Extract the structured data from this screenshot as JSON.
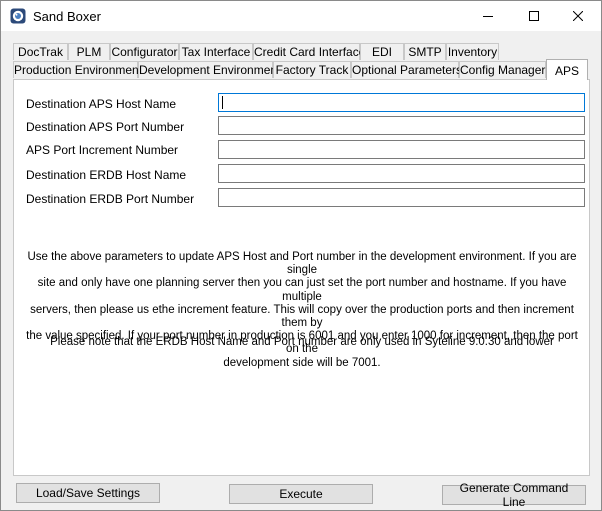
{
  "window": {
    "title": "Sand Boxer",
    "icon": "sandbox-app-icon",
    "controls": [
      "minimize-icon",
      "maximize-icon",
      "close-icon"
    ]
  },
  "tabs": {
    "row1": [
      "DocTrak",
      "PLM",
      "Configurator",
      "Tax Interface",
      "Credit Card Interface",
      "EDI",
      "SMTP",
      "Inventory"
    ],
    "row2": [
      "Production Environment",
      "Development Environment",
      "Factory Track",
      "Optional Parameters",
      "Config Manager",
      "APS"
    ],
    "active": "APS"
  },
  "fields": [
    {
      "label": "Destination APS Host Name",
      "value": ""
    },
    {
      "label": "Destination APS Port Number",
      "value": ""
    },
    {
      "label": "APS Port Increment Number",
      "value": ""
    },
    {
      "label": "Destination ERDB Host Name",
      "value": ""
    },
    {
      "label": "Destination ERDB Port Number",
      "value": ""
    }
  ],
  "help": {
    "lines": [
      "Use the above parameters to update APS Host and Port number in the development environment. If you are single",
      "site and only have one planning server then you can just set the port number and hostname. If you have multiple",
      "servers, then please us ethe increment feature. This will copy over the production ports and then increment them by",
      "the value specified. If your port number in production is 6001 and you enter 1000 for increment, then the port on the",
      "development side will be 7001."
    ],
    "note": "Please note that the ERDB Host Name and Port number are only used in Syteline 9.0.30 and lower"
  },
  "buttons": {
    "load_save": "Load/Save Settings",
    "execute": "Execute",
    "generate": "Generate Command Line"
  },
  "colors": {
    "focus_border": "#0078d7",
    "background": "#f0f0f0"
  }
}
